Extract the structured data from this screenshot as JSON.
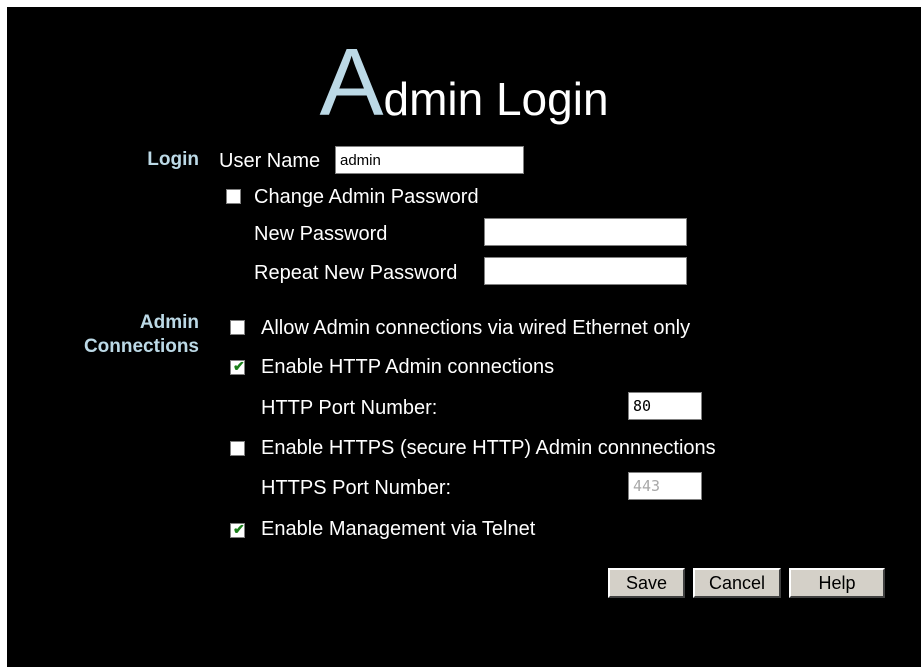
{
  "title": {
    "initial": "A",
    "rest": "dmin Login"
  },
  "login": {
    "section_label": "Login",
    "user_name_label": "User Name",
    "user_name_value": "admin",
    "change_password_label": "Change Admin Password",
    "change_password_checked": false,
    "new_password_label": "New Password",
    "new_password_value": "",
    "repeat_password_label": "Repeat New Password",
    "repeat_password_value": ""
  },
  "admin_connections": {
    "section_label_line1": "Admin",
    "section_label_line2": "Connections",
    "wired_only_label": "Allow Admin connections via wired Ethernet only",
    "wired_only_checked": false,
    "http_enable_label": "Enable HTTP Admin connections",
    "http_enable_checked": true,
    "http_port_label": "HTTP Port Number:",
    "http_port_value": "80",
    "https_enable_label": "Enable HTTPS (secure HTTP) Admin connnections",
    "https_enable_checked": false,
    "https_port_label": "HTTPS Port Number:",
    "https_port_value": "443",
    "telnet_label": "Enable Management via Telnet",
    "telnet_checked": true
  },
  "buttons": {
    "save": "Save",
    "cancel": "Cancel",
    "help": "Help"
  },
  "colors": {
    "background": "#000000",
    "title_accent": "#bcd9e6",
    "section_label": "#bcd9e6",
    "text": "#ffffff"
  }
}
